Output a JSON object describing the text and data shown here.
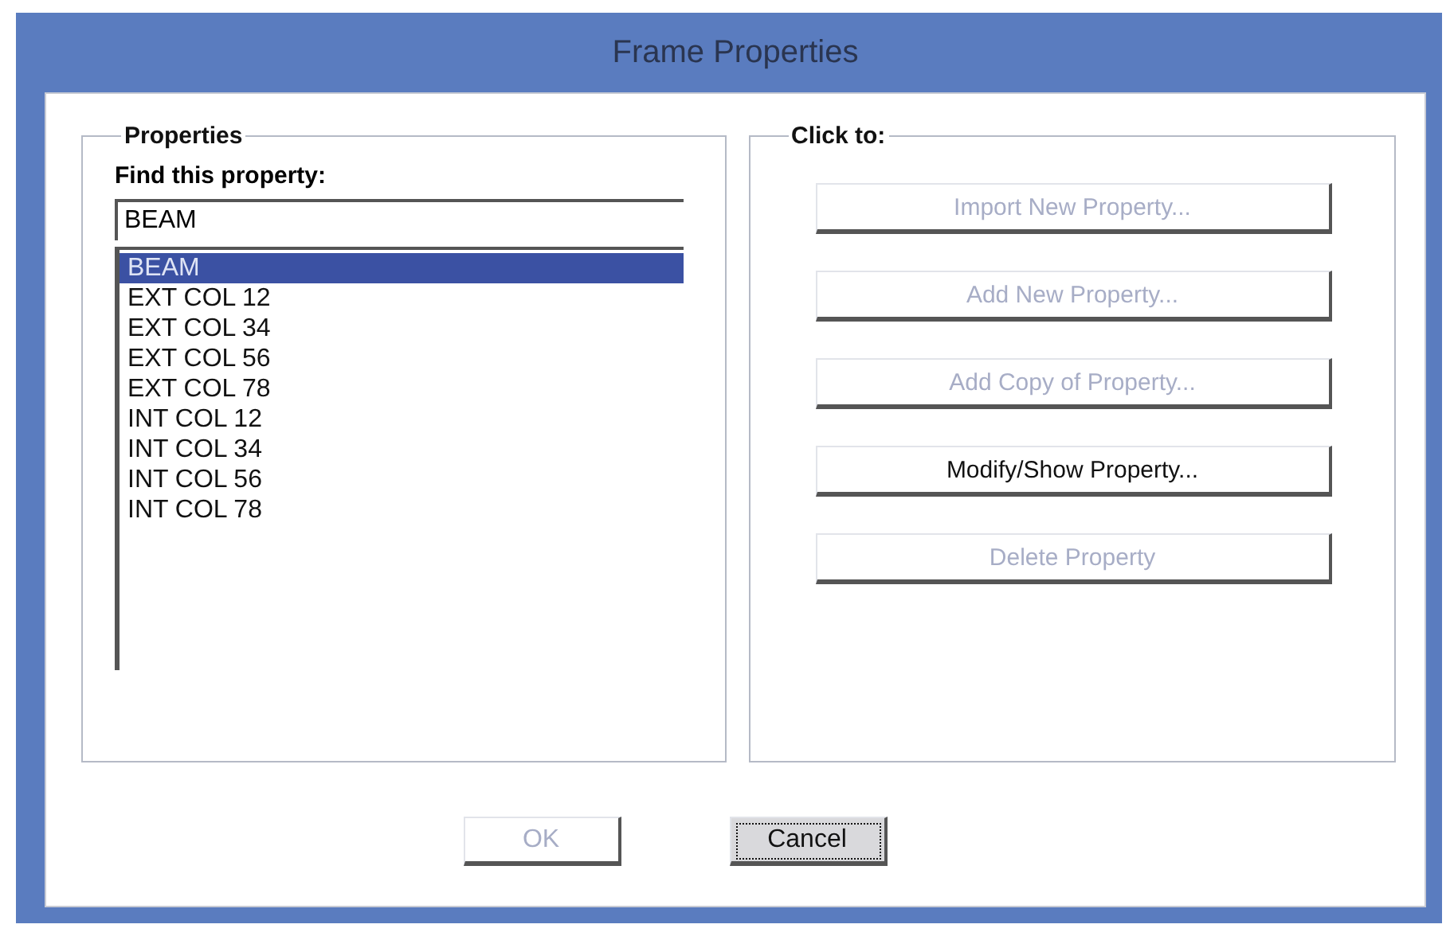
{
  "window": {
    "title": "Frame Properties"
  },
  "properties": {
    "title": "Properties",
    "find_label": "Find this property:",
    "find_value": "BEAM",
    "items": [
      {
        "label": "BEAM",
        "selected": true
      },
      {
        "label": "EXT COL 12",
        "selected": false
      },
      {
        "label": "EXT COL 34",
        "selected": false
      },
      {
        "label": "EXT COL 56",
        "selected": false
      },
      {
        "label": "EXT COL 78",
        "selected": false
      },
      {
        "label": "INT COL 12",
        "selected": false
      },
      {
        "label": "INT COL 34",
        "selected": false
      },
      {
        "label": "INT COL 56",
        "selected": false
      },
      {
        "label": "INT COL 78",
        "selected": false
      }
    ]
  },
  "actions": {
    "title": "Click to:",
    "buttons": [
      {
        "label": "Import New Property...",
        "disabled": true
      },
      {
        "label": "Add New Property...",
        "disabled": true
      },
      {
        "label": "Add Copy of Property...",
        "disabled": true
      },
      {
        "label": "Modify/Show Property...",
        "disabled": false
      },
      {
        "label": "Delete Property",
        "disabled": true
      }
    ]
  },
  "buttons": [
    {
      "label": "OK",
      "disabled": true,
      "focused": false
    },
    {
      "label": "Cancel",
      "disabled": false,
      "focused": true
    }
  ]
}
